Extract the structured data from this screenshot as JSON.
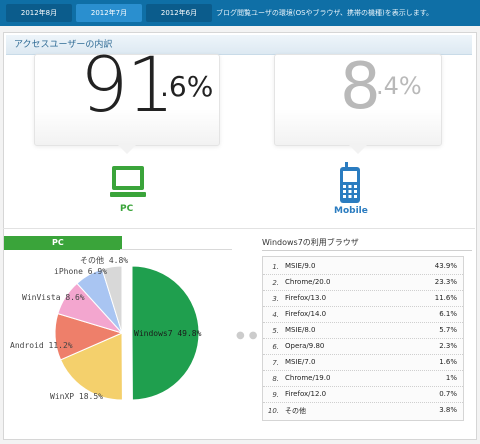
{
  "tabs": [
    {
      "label": "2012年8月",
      "active": false
    },
    {
      "label": "2012年7月",
      "active": true
    },
    {
      "label": "2012年6月",
      "active": false
    }
  ],
  "header_description": "ブログ閲覧ユーザの環境(OSやブラウザ、携帯の機種)を表示します。",
  "section_title": "アクセスユーザーの内訳",
  "device_split": {
    "pc": {
      "whole": "91",
      "fraction": ".6%",
      "label": "PC",
      "value": 91.6,
      "icon": "desktop-monitor-icon",
      "color": "#3aa43a"
    },
    "mobile": {
      "whole": "8",
      "fraction": ".4%",
      "label": "Mobile",
      "value": 8.4,
      "icon": "mobile-phone-icon",
      "color": "#2b7cc0"
    }
  },
  "pc_section_label": "PC",
  "chart_data": {
    "type": "pie",
    "title": "",
    "slices": [
      {
        "label": "Windows7 49.8%",
        "value": 49.8,
        "color": "#1f9f4e"
      },
      {
        "label": "WinXP 18.5%",
        "value": 18.5,
        "color": "#f4d06c"
      },
      {
        "label": "Android 11.2%",
        "value": 11.2,
        "color": "#ee7f6a"
      },
      {
        "label": "WinVista 8.6%",
        "value": 8.6,
        "color": "#f3a6cf"
      },
      {
        "label": "iPhone 6.9%",
        "value": 6.9,
        "color": "#a9c5f2"
      },
      {
        "label": "その他 4.8%",
        "value": 4.8,
        "color": "#d8d8d8"
      }
    ]
  },
  "browser_table": {
    "title": "Windows7の利用ブラウザ",
    "rows": [
      {
        "rank": "1.",
        "name": "MSIE/9.0",
        "pct": "43.9%"
      },
      {
        "rank": "2.",
        "name": "Chrome/20.0",
        "pct": "23.3%"
      },
      {
        "rank": "3.",
        "name": "Firefox/13.0",
        "pct": "11.6%"
      },
      {
        "rank": "4.",
        "name": "Firefox/14.0",
        "pct": "6.1%"
      },
      {
        "rank": "5.",
        "name": "MSIE/8.0",
        "pct": "5.7%"
      },
      {
        "rank": "6.",
        "name": "Opera/9.80",
        "pct": "2.3%"
      },
      {
        "rank": "7.",
        "name": "MSIE/7.0",
        "pct": "1.6%"
      },
      {
        "rank": "8.",
        "name": "Chrome/19.0",
        "pct": "1%"
      },
      {
        "rank": "9.",
        "name": "Firefox/12.0",
        "pct": "0.7%"
      },
      {
        "rank": "10.",
        "name": "その他",
        "pct": "3.8%"
      }
    ]
  }
}
